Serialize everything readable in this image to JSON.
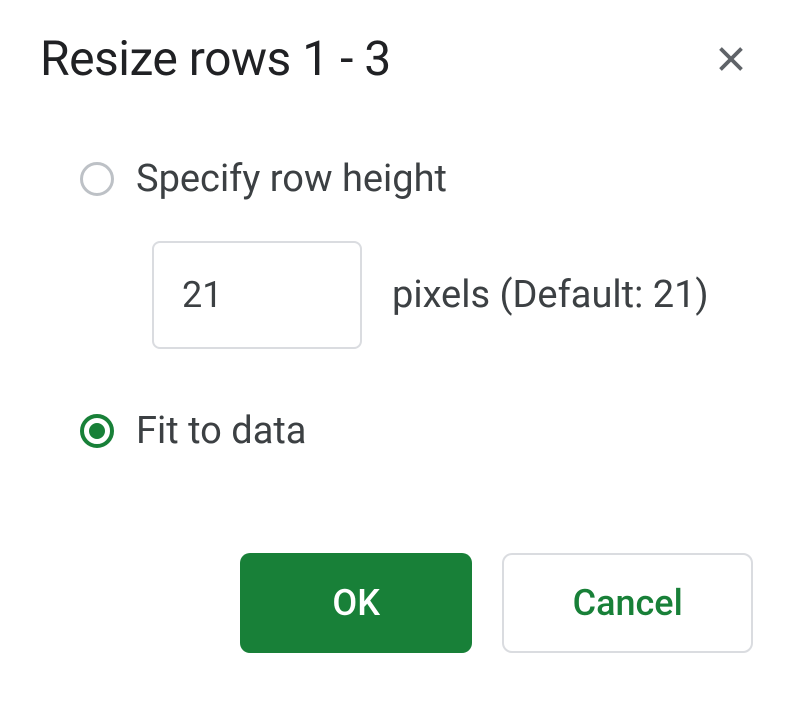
{
  "dialog": {
    "title": "Resize rows 1 - 3",
    "options": {
      "specify": {
        "label": "Specify row height",
        "value": "21",
        "suffix": "pixels (Default: 21)",
        "selected": false
      },
      "fit": {
        "label": "Fit to data",
        "selected": true
      }
    },
    "buttons": {
      "ok": "OK",
      "cancel": "Cancel"
    }
  }
}
